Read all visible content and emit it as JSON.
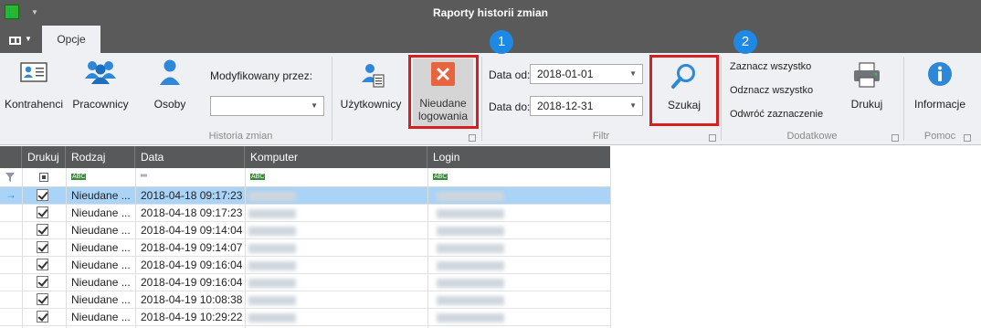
{
  "window": {
    "title": "Raporty historii zmian"
  },
  "tabs": {
    "active": "Opcje"
  },
  "ribbon": {
    "historia": {
      "group_label": "Historia zmian",
      "kontrahenci": "Kontrahenci",
      "pracownicy": "Pracownicy",
      "osoby": "Osoby",
      "modified_by_label": "Modyfikowany przez:",
      "modified_by_value": "",
      "uzytkownicy": "Użytkownicy",
      "nieudane_line1": "Nieudane",
      "nieudane_line2": "logowania"
    },
    "filtr": {
      "group_label": "Filtr",
      "date_from_label": "Data od:",
      "date_from_value": "2018-01-01",
      "date_to_label": "Data do:",
      "date_to_value": "2018-12-31",
      "search_label": "Szukaj"
    },
    "dodatkowe": {
      "group_label": "Dodatkowe",
      "select_all": "Zaznacz wszystko",
      "deselect_all": "Odznacz wszystko",
      "invert": "Odwróć zaznaczenie",
      "print": "Drukuj"
    },
    "pomoc": {
      "group_label": "Pomoc",
      "info": "Informacje"
    },
    "badges": {
      "one": "1",
      "two": "2"
    }
  },
  "grid": {
    "columns": [
      "Drukuj",
      "Rodzaj",
      "Data",
      "Komputer",
      "Login"
    ],
    "filter_row": {
      "text_glyph": "ABC",
      "equals_glyph": "═"
    },
    "rows": [
      {
        "checked": true,
        "rodzaj": "Nieudane ...",
        "data": "2018-04-18 09:17:23",
        "selected": true
      },
      {
        "checked": true,
        "rodzaj": "Nieudane ...",
        "data": "2018-04-18 09:17:23"
      },
      {
        "checked": true,
        "rodzaj": "Nieudane ...",
        "data": "2018-04-19 09:14:04"
      },
      {
        "checked": true,
        "rodzaj": "Nieudane ...",
        "data": "2018-04-19 09:14:07"
      },
      {
        "checked": true,
        "rodzaj": "Nieudane ...",
        "data": "2018-04-19 09:16:04"
      },
      {
        "checked": true,
        "rodzaj": "Nieudane ...",
        "data": "2018-04-19 09:16:04"
      },
      {
        "checked": true,
        "rodzaj": "Nieudane ...",
        "data": "2018-04-19 10:08:38"
      },
      {
        "checked": true,
        "rodzaj": "Nieudane ...",
        "data": "2018-04-19 10:29:22"
      }
    ]
  },
  "colors": {
    "selected_row": "#a9d3f7",
    "highlight": "#d6201f",
    "badge": "#1e88e5",
    "header": "#58595b"
  }
}
